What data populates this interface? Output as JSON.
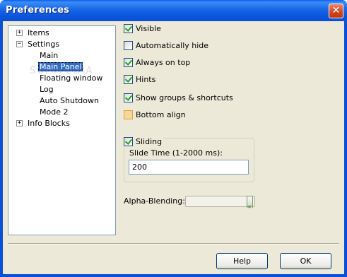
{
  "window": {
    "title": "Preferences",
    "close_glyph": "✕"
  },
  "tree": {
    "items": [
      {
        "label": "Items",
        "expander": "+"
      },
      {
        "label": "Settings",
        "expander": "−"
      },
      {
        "label": "Main"
      },
      {
        "label": "Main Panel",
        "selected": true
      },
      {
        "label": "Floating window"
      },
      {
        "label": "Log"
      },
      {
        "label": "Auto Shutdown"
      },
      {
        "label": "Mode 2"
      },
      {
        "label": "Info Blocks",
        "expander": "+"
      }
    ],
    "watermark": "SOFTPEDIA"
  },
  "options": {
    "visible": {
      "label": "Visible",
      "checked": true
    },
    "auto_hide": {
      "label": "Automatically hide",
      "checked": false
    },
    "always_on_top": {
      "label": "Always on top",
      "checked": true
    },
    "hints": {
      "label": "Hints",
      "checked": true
    },
    "show_groups": {
      "label": "Show groups & shortcuts",
      "checked": true
    },
    "bottom_align": {
      "label": "Bottom align",
      "checked": false
    }
  },
  "sliding": {
    "label": "Sliding",
    "checked": true,
    "time_label": "Slide Time (1-2000 ms):",
    "time_value": "200"
  },
  "alpha": {
    "label": "Alpha-Blending:",
    "level": 1.0
  },
  "buttons": {
    "help": "Help",
    "ok": "OK"
  },
  "colors": {
    "title_bar": "#0a55de",
    "selection": "#316ac5",
    "checkmark": "#21a121"
  }
}
